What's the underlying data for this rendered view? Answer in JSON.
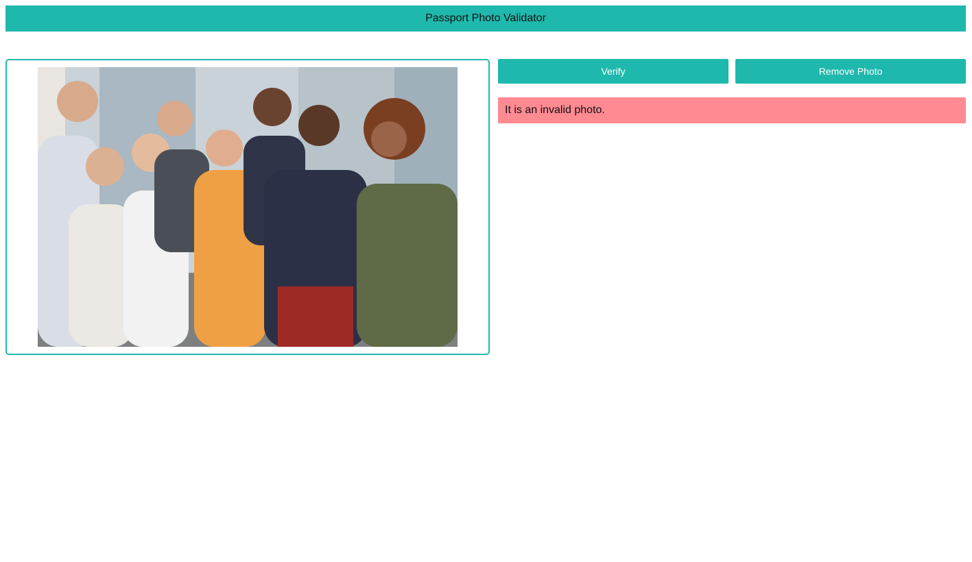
{
  "header": {
    "title": "Passport Photo Validator"
  },
  "actions": {
    "verify_label": "Verify",
    "remove_label": "Remove Photo"
  },
  "result": {
    "message": "It is an invalid photo.",
    "status_color": "#ff8a92"
  },
  "theme": {
    "accent": "#1fb8ad"
  }
}
